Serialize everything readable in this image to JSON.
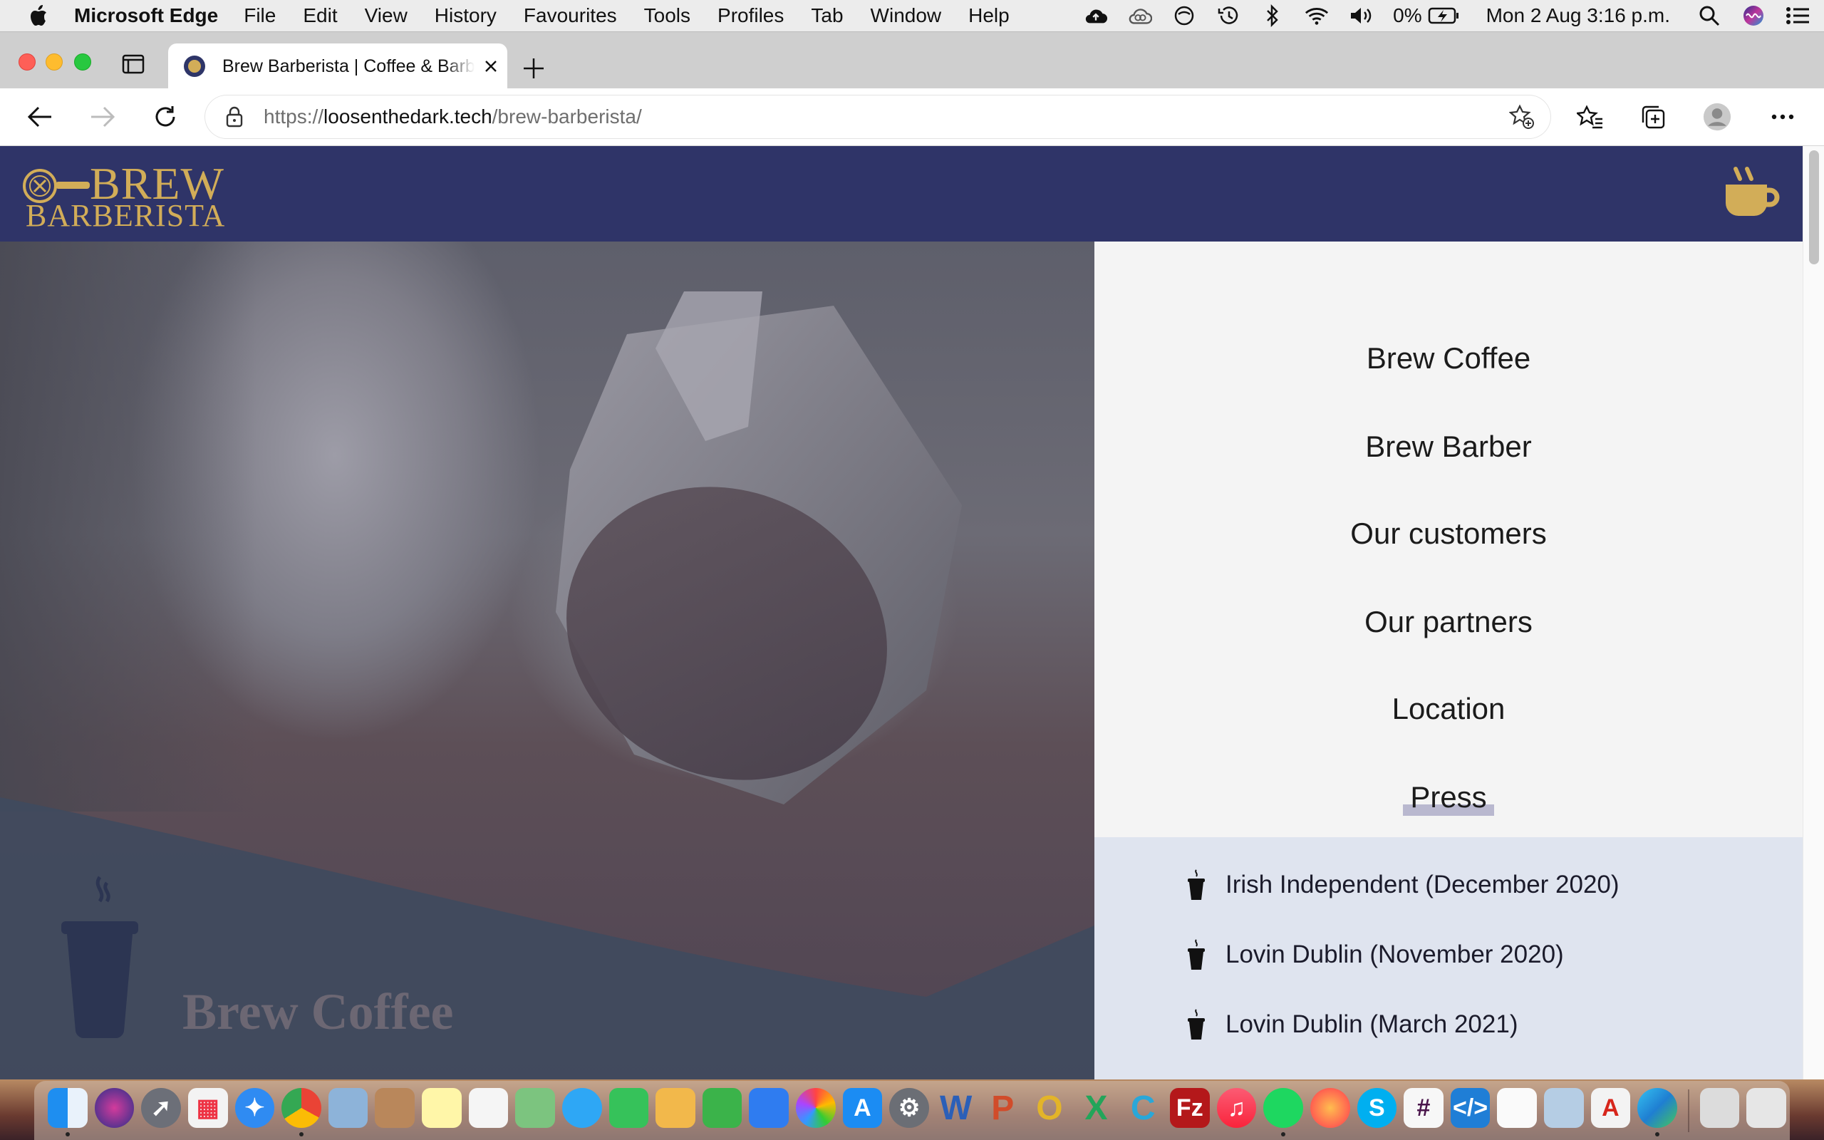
{
  "menubar": {
    "app_name": "Microsoft Edge",
    "menus": [
      "File",
      "Edit",
      "View",
      "History",
      "Favourites",
      "Tools",
      "Profiles",
      "Tab",
      "Window",
      "Help"
    ],
    "battery": "0%",
    "clock": "Mon 2 Aug  3:16 p.m.",
    "status_icons": [
      "cloud-upload-icon",
      "creative-cloud-icon",
      "do-not-disturb-icon",
      "time-machine-icon",
      "bluetooth-icon",
      "wifi-icon",
      "volume-icon",
      "battery-icon",
      "spotlight-icon",
      "siri-icon",
      "notification-center-icon"
    ]
  },
  "browser": {
    "tab_title": "Brew Barberista | Coffee & Barber",
    "url_scheme": "https://",
    "url_host": "loosenthedark.tech",
    "url_path": "/brew-barberista/"
  },
  "site": {
    "logo_top": "BREW",
    "logo_bottom": "BARBERISTA",
    "colors": {
      "header_bg": "#2f3468",
      "gold": "#d2ad58",
      "nav_bg": "#f4f4f4",
      "press_bg": "#dfe4ef",
      "active_underline": "#b9b8cf"
    },
    "nav": [
      {
        "label": "Brew Coffee",
        "active": false
      },
      {
        "label": "Brew Barber",
        "active": false
      },
      {
        "label": "Our customers",
        "active": false
      },
      {
        "label": "Our partners",
        "active": false
      },
      {
        "label": "Location",
        "active": false
      },
      {
        "label": "Press",
        "active": true
      }
    ],
    "press": [
      "Irish Independent (December 2020)",
      "Lovin Dublin (November 2020)",
      "Lovin Dublin (March 2021)"
    ],
    "hero_title": "Brew Coffee"
  },
  "dock": {
    "apps": [
      "finder",
      "siri",
      "launchpad",
      "app-grid",
      "safari",
      "chrome",
      "preview-bird",
      "contacts",
      "notes",
      "reminders",
      "maps",
      "messages",
      "facetime",
      "keynote-viewer",
      "numbers",
      "keynote",
      "photos",
      "app-store",
      "system-preferences",
      "word",
      "powerpoint",
      "outlook",
      "excel",
      "c-app",
      "filezilla",
      "music",
      "spotify",
      "firefox",
      "skype",
      "slack",
      "vscode",
      "textedit",
      "image-viewer",
      "acrobat",
      "edge",
      "screen-sharing",
      "trash"
    ]
  }
}
